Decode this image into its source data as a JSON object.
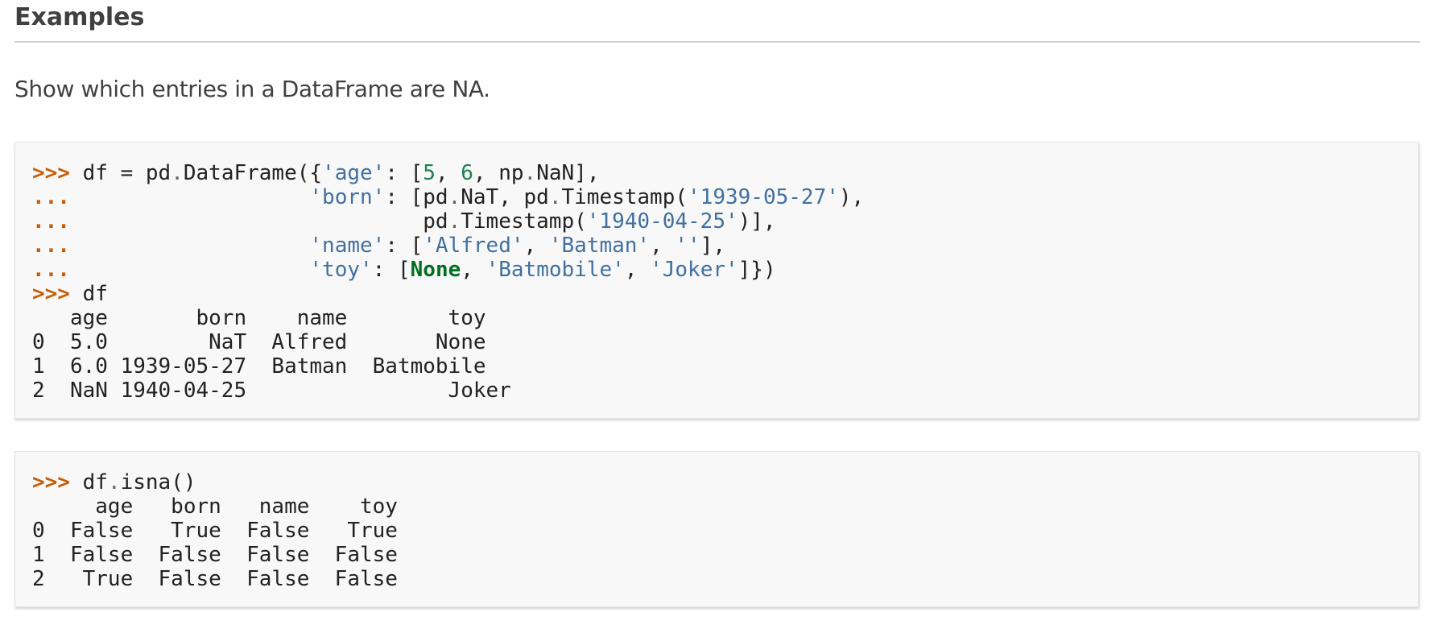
{
  "heading": "Examples",
  "intro": "Show which entries in a DataFrame are NA.",
  "colors": {
    "prompt": "#c65d09",
    "string": "#4070a0",
    "number": "#208050",
    "keyword_constant": "#007020",
    "code_background": "#f8f8f8"
  },
  "code1": {
    "lines": [
      [
        {
          "t": ">>>",
          "c": "gp"
        },
        {
          "t": " df = pd"
        },
        {
          "t": ".",
          "c": "o"
        },
        {
          "t": "DataFrame({"
        },
        {
          "t": "'age'",
          "c": "s"
        },
        {
          "t": ": ["
        },
        {
          "t": "5",
          "c": "mi"
        },
        {
          "t": ", "
        },
        {
          "t": "6",
          "c": "mi"
        },
        {
          "t": ", np"
        },
        {
          "t": ".",
          "c": "o"
        },
        {
          "t": "NaN],"
        }
      ],
      [
        {
          "t": "...",
          "c": "gp"
        },
        {
          "t": "                   "
        },
        {
          "t": "'born'",
          "c": "s"
        },
        {
          "t": ": [pd"
        },
        {
          "t": ".",
          "c": "o"
        },
        {
          "t": "NaT, pd"
        },
        {
          "t": ".",
          "c": "o"
        },
        {
          "t": "Timestamp("
        },
        {
          "t": "'1939-05-27'",
          "c": "s"
        },
        {
          "t": "),"
        }
      ],
      [
        {
          "t": "...",
          "c": "gp"
        },
        {
          "t": "                            pd"
        },
        {
          "t": ".",
          "c": "o"
        },
        {
          "t": "Timestamp("
        },
        {
          "t": "'1940-04-25'",
          "c": "s"
        },
        {
          "t": ")],"
        }
      ],
      [
        {
          "t": "...",
          "c": "gp"
        },
        {
          "t": "                   "
        },
        {
          "t": "'name'",
          "c": "s"
        },
        {
          "t": ": ["
        },
        {
          "t": "'Alfred'",
          "c": "s"
        },
        {
          "t": ", "
        },
        {
          "t": "'Batman'",
          "c": "s"
        },
        {
          "t": ", "
        },
        {
          "t": "''",
          "c": "s"
        },
        {
          "t": "],"
        }
      ],
      [
        {
          "t": "...",
          "c": "gp"
        },
        {
          "t": "                   "
        },
        {
          "t": "'toy'",
          "c": "s"
        },
        {
          "t": ": ["
        },
        {
          "t": "None",
          "c": "kc"
        },
        {
          "t": ", "
        },
        {
          "t": "'Batmobile'",
          "c": "s"
        },
        {
          "t": ", "
        },
        {
          "t": "'Joker'",
          "c": "s"
        },
        {
          "t": "]})"
        }
      ],
      [
        {
          "t": ">>>",
          "c": "gp"
        },
        {
          "t": " df"
        }
      ],
      [
        {
          "t": "   age       born    name        toy"
        }
      ],
      [
        {
          "t": "0  5.0        NaT  Alfred       None"
        }
      ],
      [
        {
          "t": "1  6.0 1939-05-27  Batman  Batmobile"
        }
      ],
      [
        {
          "t": "2  NaN 1940-04-25                Joker"
        }
      ]
    ]
  },
  "code2": {
    "lines": [
      [
        {
          "t": ">>>",
          "c": "gp"
        },
        {
          "t": " df"
        },
        {
          "t": ".",
          "c": "o"
        },
        {
          "t": "isna()"
        }
      ],
      [
        {
          "t": "     age   born   name    toy"
        }
      ],
      [
        {
          "t": "0  False   True  False   True"
        }
      ],
      [
        {
          "t": "1  False  False  False  False"
        }
      ],
      [
        {
          "t": "2   True  False  False  False"
        }
      ]
    ]
  }
}
